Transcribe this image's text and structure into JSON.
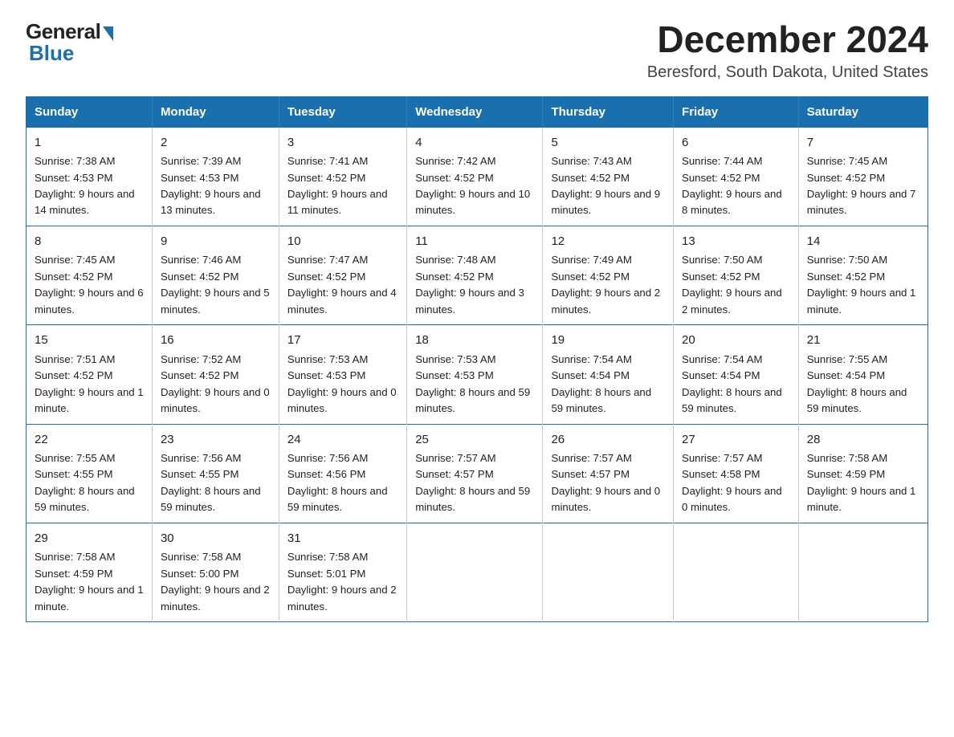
{
  "logo": {
    "general": "General",
    "blue": "Blue"
  },
  "header": {
    "title": "December 2024",
    "subtitle": "Beresford, South Dakota, United States"
  },
  "days_of_week": [
    "Sunday",
    "Monday",
    "Tuesday",
    "Wednesday",
    "Thursday",
    "Friday",
    "Saturday"
  ],
  "weeks": [
    [
      {
        "num": "1",
        "sunrise": "7:38 AM",
        "sunset": "4:53 PM",
        "daylight": "9 hours and 14 minutes."
      },
      {
        "num": "2",
        "sunrise": "7:39 AM",
        "sunset": "4:53 PM",
        "daylight": "9 hours and 13 minutes."
      },
      {
        "num": "3",
        "sunrise": "7:41 AM",
        "sunset": "4:52 PM",
        "daylight": "9 hours and 11 minutes."
      },
      {
        "num": "4",
        "sunrise": "7:42 AM",
        "sunset": "4:52 PM",
        "daylight": "9 hours and 10 minutes."
      },
      {
        "num": "5",
        "sunrise": "7:43 AM",
        "sunset": "4:52 PM",
        "daylight": "9 hours and 9 minutes."
      },
      {
        "num": "6",
        "sunrise": "7:44 AM",
        "sunset": "4:52 PM",
        "daylight": "9 hours and 8 minutes."
      },
      {
        "num": "7",
        "sunrise": "7:45 AM",
        "sunset": "4:52 PM",
        "daylight": "9 hours and 7 minutes."
      }
    ],
    [
      {
        "num": "8",
        "sunrise": "7:45 AM",
        "sunset": "4:52 PM",
        "daylight": "9 hours and 6 minutes."
      },
      {
        "num": "9",
        "sunrise": "7:46 AM",
        "sunset": "4:52 PM",
        "daylight": "9 hours and 5 minutes."
      },
      {
        "num": "10",
        "sunrise": "7:47 AM",
        "sunset": "4:52 PM",
        "daylight": "9 hours and 4 minutes."
      },
      {
        "num": "11",
        "sunrise": "7:48 AM",
        "sunset": "4:52 PM",
        "daylight": "9 hours and 3 minutes."
      },
      {
        "num": "12",
        "sunrise": "7:49 AM",
        "sunset": "4:52 PM",
        "daylight": "9 hours and 2 minutes."
      },
      {
        "num": "13",
        "sunrise": "7:50 AM",
        "sunset": "4:52 PM",
        "daylight": "9 hours and 2 minutes."
      },
      {
        "num": "14",
        "sunrise": "7:50 AM",
        "sunset": "4:52 PM",
        "daylight": "9 hours and 1 minute."
      }
    ],
    [
      {
        "num": "15",
        "sunrise": "7:51 AM",
        "sunset": "4:52 PM",
        "daylight": "9 hours and 1 minute."
      },
      {
        "num": "16",
        "sunrise": "7:52 AM",
        "sunset": "4:52 PM",
        "daylight": "9 hours and 0 minutes."
      },
      {
        "num": "17",
        "sunrise": "7:53 AM",
        "sunset": "4:53 PM",
        "daylight": "9 hours and 0 minutes."
      },
      {
        "num": "18",
        "sunrise": "7:53 AM",
        "sunset": "4:53 PM",
        "daylight": "8 hours and 59 minutes."
      },
      {
        "num": "19",
        "sunrise": "7:54 AM",
        "sunset": "4:54 PM",
        "daylight": "8 hours and 59 minutes."
      },
      {
        "num": "20",
        "sunrise": "7:54 AM",
        "sunset": "4:54 PM",
        "daylight": "8 hours and 59 minutes."
      },
      {
        "num": "21",
        "sunrise": "7:55 AM",
        "sunset": "4:54 PM",
        "daylight": "8 hours and 59 minutes."
      }
    ],
    [
      {
        "num": "22",
        "sunrise": "7:55 AM",
        "sunset": "4:55 PM",
        "daylight": "8 hours and 59 minutes."
      },
      {
        "num": "23",
        "sunrise": "7:56 AM",
        "sunset": "4:55 PM",
        "daylight": "8 hours and 59 minutes."
      },
      {
        "num": "24",
        "sunrise": "7:56 AM",
        "sunset": "4:56 PM",
        "daylight": "8 hours and 59 minutes."
      },
      {
        "num": "25",
        "sunrise": "7:57 AM",
        "sunset": "4:57 PM",
        "daylight": "8 hours and 59 minutes."
      },
      {
        "num": "26",
        "sunrise": "7:57 AM",
        "sunset": "4:57 PM",
        "daylight": "9 hours and 0 minutes."
      },
      {
        "num": "27",
        "sunrise": "7:57 AM",
        "sunset": "4:58 PM",
        "daylight": "9 hours and 0 minutes."
      },
      {
        "num": "28",
        "sunrise": "7:58 AM",
        "sunset": "4:59 PM",
        "daylight": "9 hours and 1 minute."
      }
    ],
    [
      {
        "num": "29",
        "sunrise": "7:58 AM",
        "sunset": "4:59 PM",
        "daylight": "9 hours and 1 minute."
      },
      {
        "num": "30",
        "sunrise": "7:58 AM",
        "sunset": "5:00 PM",
        "daylight": "9 hours and 2 minutes."
      },
      {
        "num": "31",
        "sunrise": "7:58 AM",
        "sunset": "5:01 PM",
        "daylight": "9 hours and 2 minutes."
      },
      null,
      null,
      null,
      null
    ]
  ]
}
